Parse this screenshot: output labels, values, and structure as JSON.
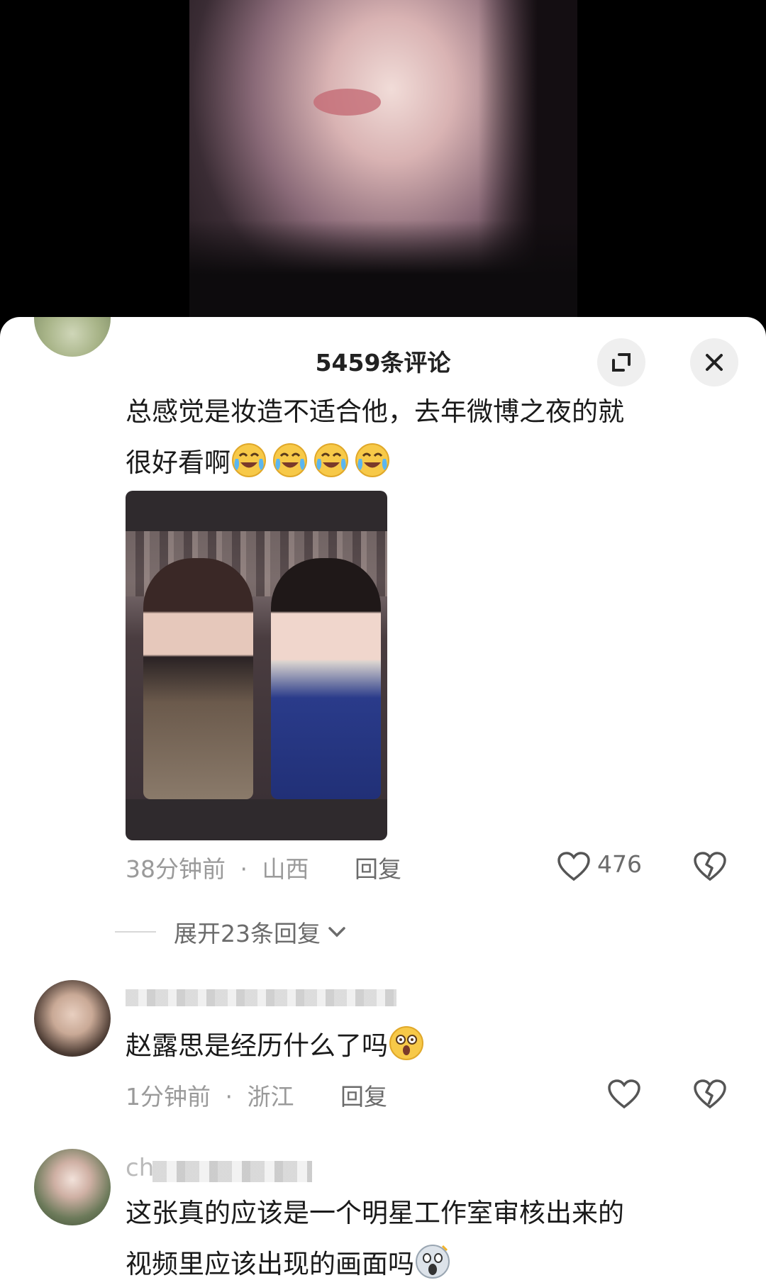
{
  "sheet": {
    "title": "5459条评论"
  },
  "comments": [
    {
      "text_line1": "总感觉是妆造不适合他，去年微博之夜的就",
      "text_line2": "很好看啊",
      "emoji": "crying-laughing-emoji",
      "emoji_count": 4,
      "time": "38分钟前",
      "location": "山西",
      "reply_label": "回复",
      "like_count": "476",
      "expand_replies": "展开23条回复"
    },
    {
      "text": "赵露思是经历什么了吗",
      "emoji": "shocked-face-emoji",
      "time": "1分钟前",
      "location": "浙江",
      "reply_label": "回复"
    },
    {
      "username_visible": "ch",
      "text_line1": "这张真的应该是一个明星工作室审核出来的",
      "text_line2": "视频里应该出现的画面吗",
      "emoji": "screaming-face-emoji"
    }
  ],
  "separator": "·",
  "colors": {
    "sheet_bg": "#ffffff",
    "text_primary": "#1a1a1a",
    "text_meta": "#9a9a9a",
    "button_bg": "#efefef"
  }
}
